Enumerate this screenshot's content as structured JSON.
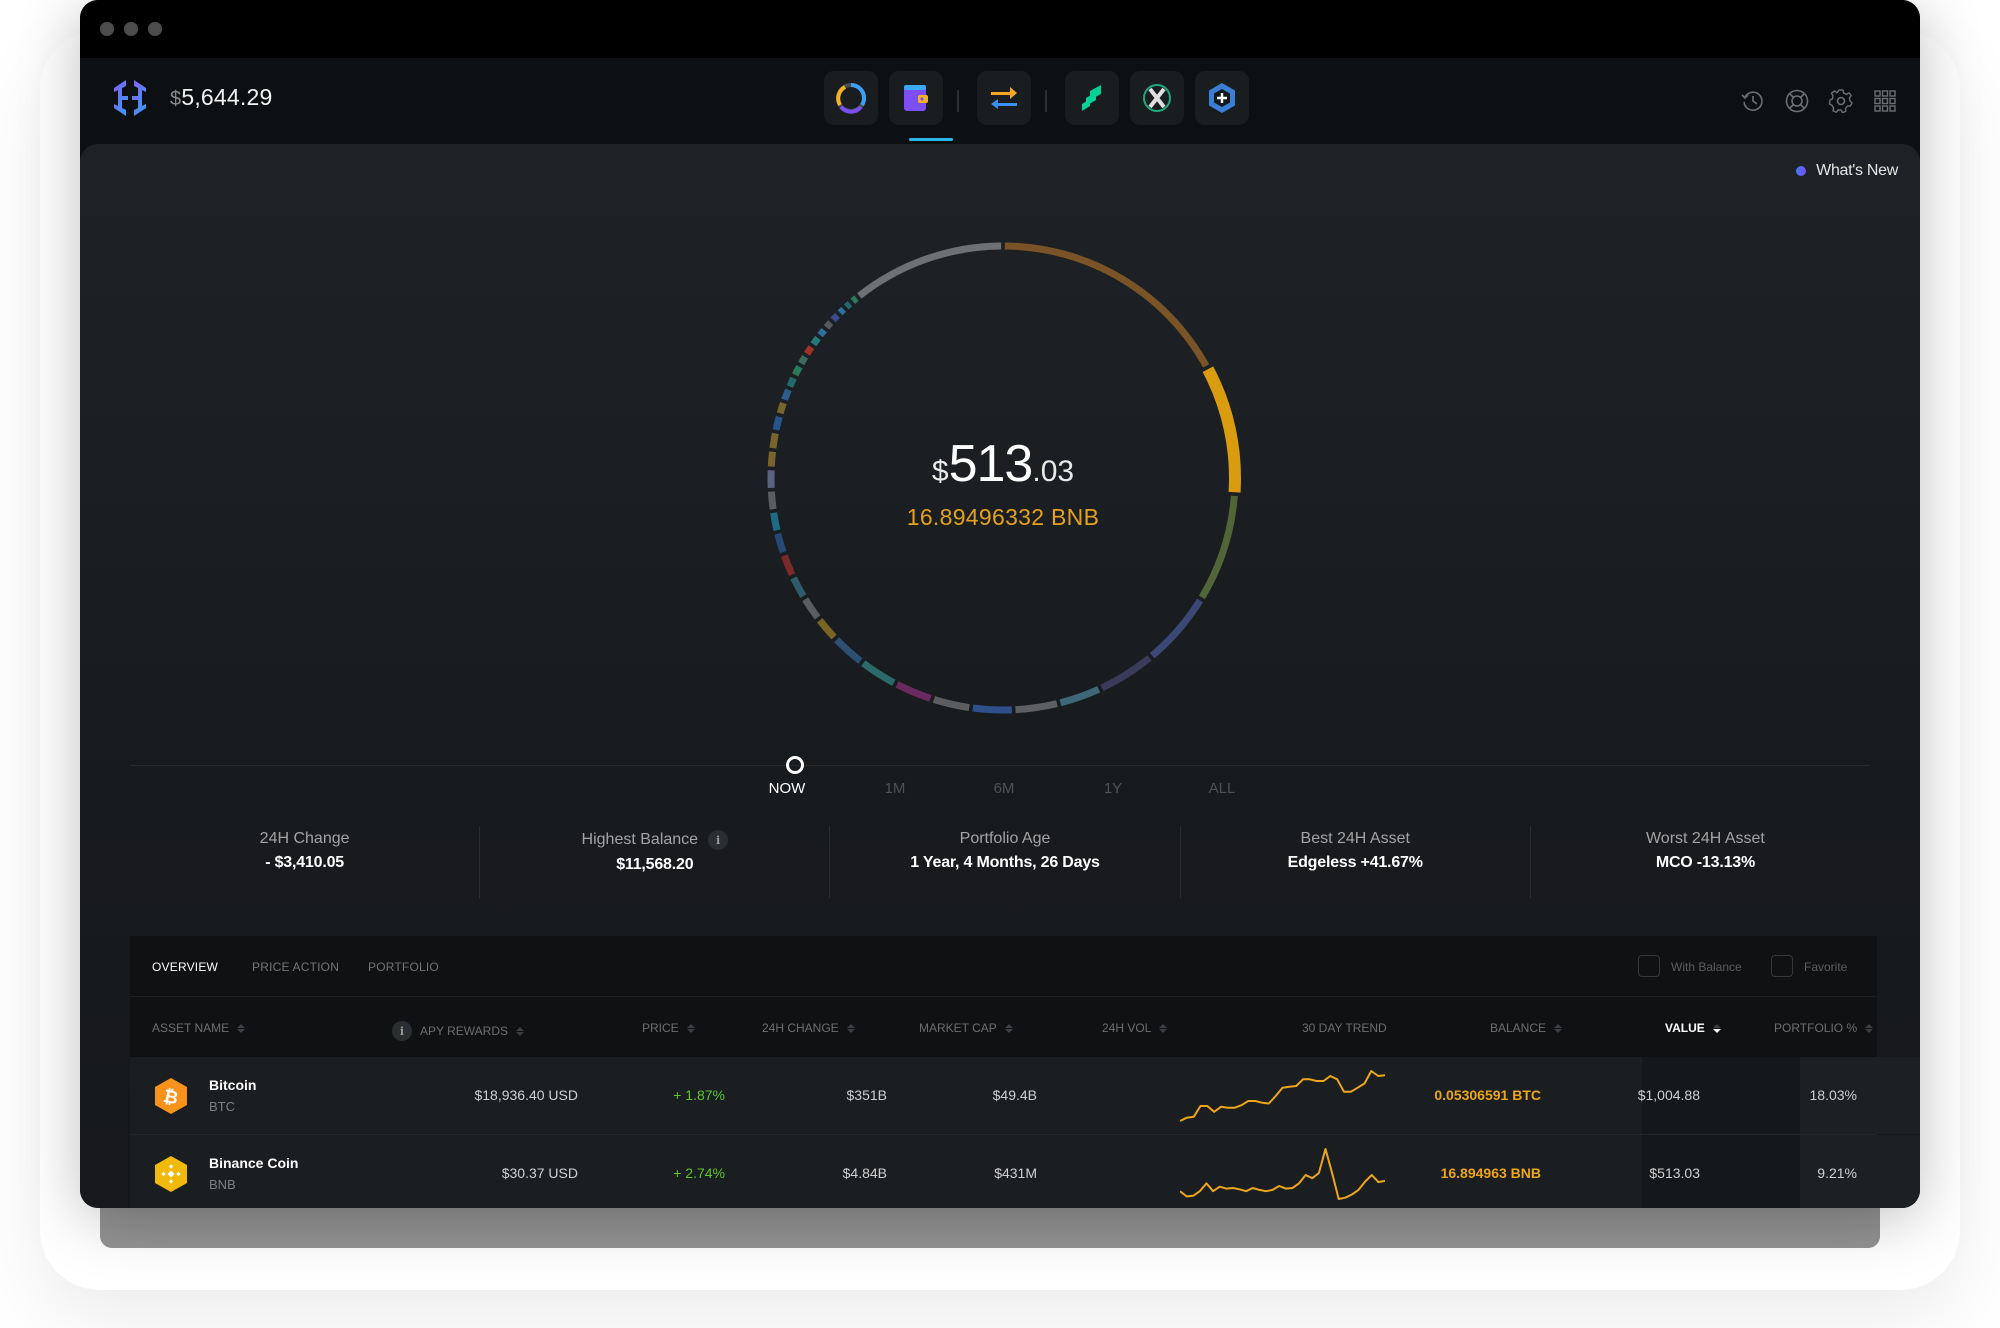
{
  "header": {
    "currency_symbol": "$",
    "total_balance": "5,644.29",
    "nav": [
      {
        "name": "portfolio-icon",
        "active": true
      },
      {
        "name": "wallet-icon",
        "active": false
      },
      {
        "name": "exchange-icon",
        "active": false
      },
      {
        "name": "compound-app-icon",
        "active": false
      },
      {
        "name": "x-app-icon",
        "active": false
      },
      {
        "name": "add-app-icon",
        "active": false
      }
    ],
    "right_icons": [
      "history-icon",
      "help-icon",
      "settings-icon",
      "apps-grid-icon"
    ]
  },
  "whats_new": "What's New",
  "center": {
    "currency_symbol": "$",
    "value_int": "513",
    "value_dec": ".03",
    "sub": "16.89496332 BNB"
  },
  "timeline": {
    "items": [
      "NOW",
      "1M",
      "6M",
      "1Y",
      "ALL"
    ],
    "active": "NOW"
  },
  "stats": [
    {
      "label": "24H Change",
      "value": "- $3,410.05"
    },
    {
      "label": "Highest Balance",
      "value": "$11,568.20",
      "info": "i"
    },
    {
      "label": "Portfolio Age",
      "value": "1 Year, 4 Months, 26 Days"
    },
    {
      "label": "Best 24H Asset",
      "value": "Edgeless +41.67%"
    },
    {
      "label": "Worst 24H Asset",
      "value": "MCO -13.13%"
    }
  ],
  "table": {
    "tabs": [
      "OVERVIEW",
      "PRICE ACTION",
      "PORTFOLIO"
    ],
    "active_tab": "OVERVIEW",
    "filters": [
      {
        "label": "With Balance",
        "checked": false
      },
      {
        "label": "Favorite",
        "checked": false
      }
    ],
    "columns": [
      "ASSET NAME",
      "APY REWARDS",
      "PRICE",
      "24H CHANGE",
      "MARKET CAP",
      "24H VOL",
      "30 DAY TREND",
      "BALANCE",
      "VALUE",
      "PORTFOLIO %"
    ],
    "info_glyph": "i",
    "sorted_column": "VALUE",
    "rows": [
      {
        "name": "Bitcoin",
        "symbol": "BTC",
        "icon": "bitcoin-icon",
        "price": "$18,936.40 USD",
        "change": "+ 1.87%",
        "market_cap": "$351B",
        "volume": "$49.4B",
        "balance": "0.05306591 BTC",
        "value": "$1,004.88",
        "portfolio_pct": "18.03%",
        "trend": [
          10,
          14,
          15,
          28,
          28,
          21,
          27,
          26,
          26,
          29,
          34,
          34,
          32,
          31,
          40,
          50,
          51,
          52,
          60,
          60,
          58,
          58,
          64,
          60,
          45,
          45,
          50,
          55,
          70,
          64,
          65
        ]
      },
      {
        "name": "Binance Coin",
        "symbol": "BNB",
        "icon": "binance-coin-icon",
        "price": "$30.37 USD",
        "change": "+ 2.74%",
        "market_cap": "$4.84B",
        "volume": "$431M",
        "balance": "16.894963 BNB",
        "value": "$513.03",
        "portfolio_pct": "9.21%",
        "trend": [
          20,
          12,
          13,
          20,
          32,
          20,
          27,
          24,
          25,
          23,
          20,
          25,
          22,
          20,
          22,
          28,
          24,
          25,
          32,
          45,
          40,
          48,
          85,
          48,
          8,
          10,
          15,
          22,
          35,
          45,
          34,
          36
        ]
      }
    ]
  },
  "ring_segments": [
    {
      "share": 17.5,
      "color": "#7a5426"
    },
    {
      "share": 9.2,
      "color": "#d99c0f"
    },
    {
      "share": 7.8,
      "color": "#526538"
    },
    {
      "share": 5.4,
      "color": "#3b4876"
    },
    {
      "share": 4.2,
      "color": "#383c5a"
    },
    {
      "share": 3.1,
      "color": "#3e6878"
    },
    {
      "share": 3.2,
      "color": "#5d5f62"
    },
    {
      "share": 3.0,
      "color": "#2f4f8a"
    },
    {
      "share": 2.8,
      "color": "#5b5d60"
    },
    {
      "share": 2.8,
      "color": "#6b2a5f"
    },
    {
      "share": 2.8,
      "color": "#2a6a6a"
    },
    {
      "share": 2.5,
      "color": "#2d4f73"
    },
    {
      "share": 1.8,
      "color": "#7a6422"
    },
    {
      "share": 1.8,
      "color": "#5b5d60"
    },
    {
      "share": 1.7,
      "color": "#2f5c68"
    },
    {
      "share": 1.7,
      "color": "#7a2a2a"
    },
    {
      "share": 1.6,
      "color": "#264a75"
    },
    {
      "share": 1.5,
      "color": "#1f6b85"
    },
    {
      "share": 1.5,
      "color": "#5b5d60"
    },
    {
      "share": 1.5,
      "color": "#5b6182"
    },
    {
      "share": 1.3,
      "color": "#7a642e"
    },
    {
      "share": 1.3,
      "color": "#7a642e"
    },
    {
      "share": 1.2,
      "color": "#25558a"
    },
    {
      "share": 1.0,
      "color": "#7a642e"
    },
    {
      "share": 1.0,
      "color": "#2d5b8a"
    },
    {
      "share": 0.9,
      "color": "#216a6a"
    },
    {
      "share": 0.9,
      "color": "#2a7a5a"
    },
    {
      "share": 0.8,
      "color": "#3b6b5c"
    },
    {
      "share": 0.8,
      "color": "#a0322a"
    },
    {
      "share": 0.8,
      "color": "#217a7a"
    },
    {
      "share": 0.7,
      "color": "#2f6fa0"
    },
    {
      "share": 0.7,
      "color": "#55585c"
    },
    {
      "share": 0.7,
      "color": "#3a4a8a"
    },
    {
      "share": 0.6,
      "color": "#2f6fa0"
    },
    {
      "share": 0.6,
      "color": "#216a6a"
    },
    {
      "share": 0.6,
      "color": "#2a7a5a"
    },
    {
      "share": 11.0,
      "color": "#6d7174"
    }
  ]
}
